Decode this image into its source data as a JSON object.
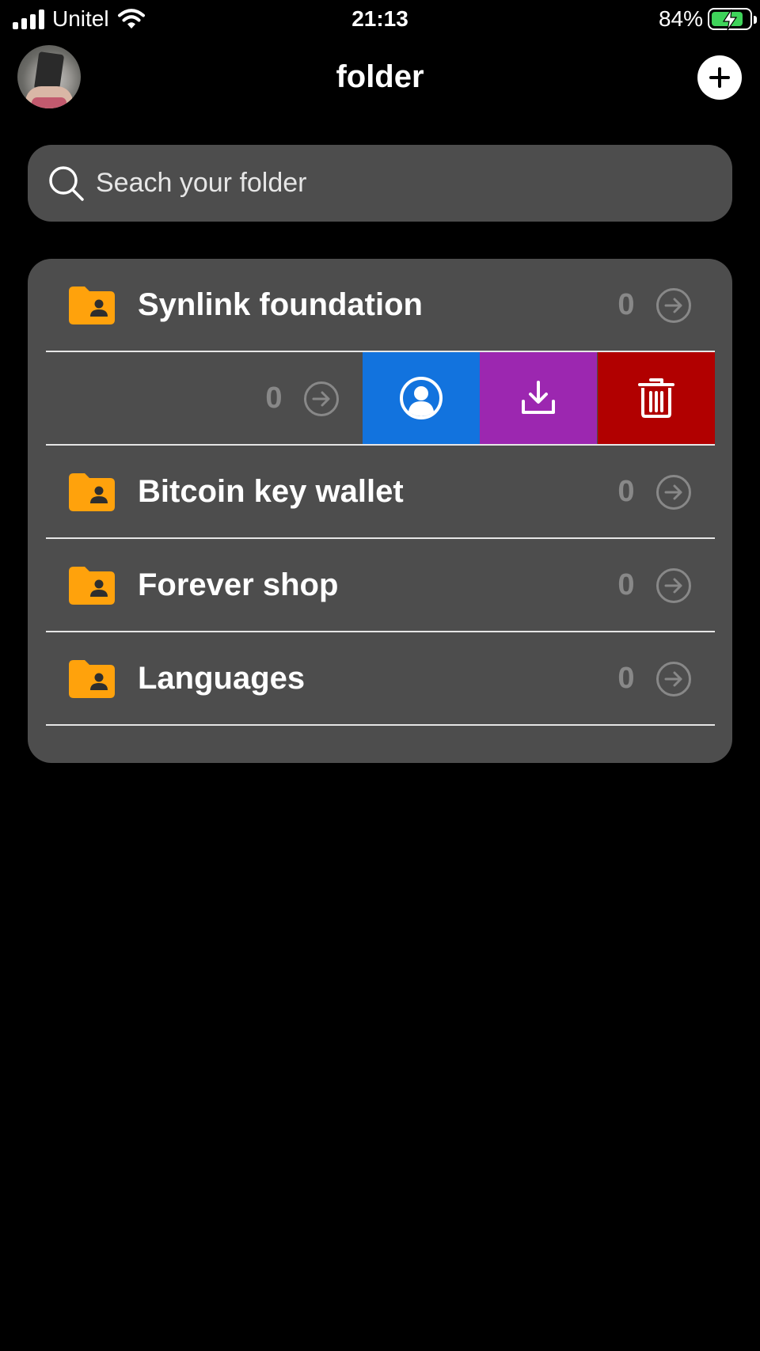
{
  "status_bar": {
    "carrier": "Unitel",
    "time": "21:13",
    "battery": "84%",
    "battery_level": 0.84,
    "signal_icon": "signal-bars-icon",
    "wifi_icon": "wifi-icon",
    "battery_icon": "battery-charging-icon"
  },
  "header": {
    "title": "folder",
    "avatar_icon": "profile-photo",
    "add_icon": "plus-icon"
  },
  "search": {
    "placeholder": "Seach your folder",
    "value": "",
    "icon": "search-icon"
  },
  "colors": {
    "folder": "#ffa20c",
    "share_action": "#1273de",
    "download_action": "#9c27b0",
    "delete_action": "#b10000",
    "card": "#4d4d4d"
  },
  "folders": [
    {
      "label": "Synlink foundation",
      "count": "0"
    },
    {
      "label": "",
      "count": "0",
      "swiped_open": true,
      "actions": [
        "person-circle-icon",
        "download-icon",
        "trash-icon"
      ]
    },
    {
      "label": "Bitcoin key wallet",
      "count": "0"
    },
    {
      "label": "Forever shop",
      "count": "0"
    },
    {
      "label": "Languages",
      "count": "0"
    }
  ]
}
